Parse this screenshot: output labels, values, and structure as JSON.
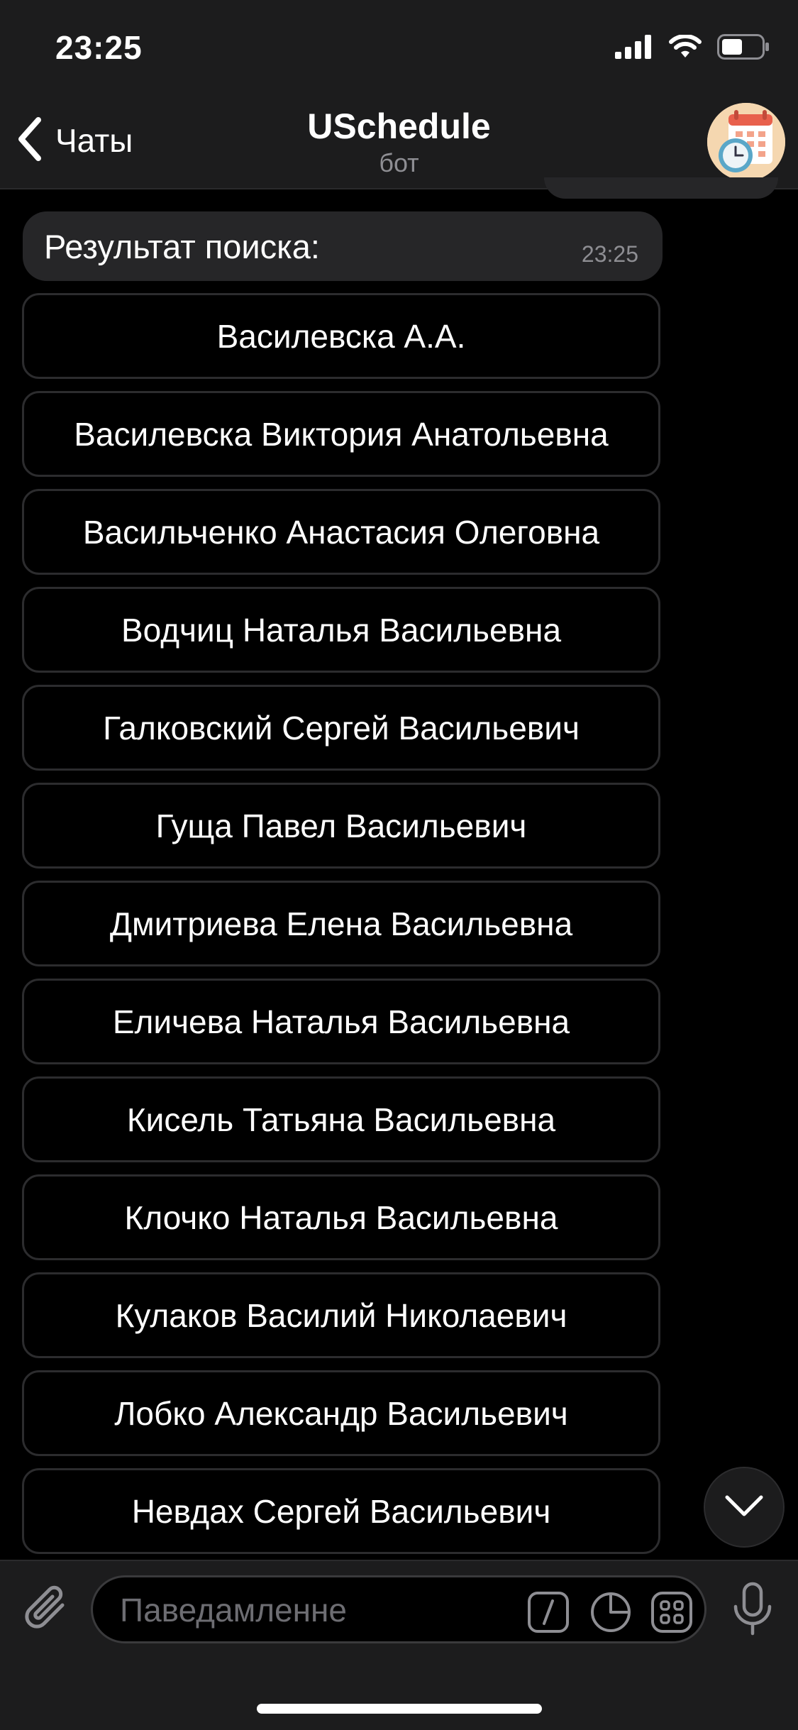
{
  "status": {
    "time": "23:25"
  },
  "nav": {
    "back_label": "Чаты",
    "title": "USchedule",
    "subtitle": "бот"
  },
  "message": {
    "text": "Результат поиска:",
    "time": "23:25"
  },
  "buttons": [
    "Василевска А.А.",
    "Василевска Виктория Анатольевна",
    "Васильченко Анастасия Олеговна",
    "Водчиц Наталья Васильевна",
    "Галковский Сергей Васильевич",
    "Гуща Павел Васильевич",
    "Дмитриева Елена Васильевна",
    "Еличева Наталья Васильевна",
    "Кисель Татьяна Васильевна",
    "Клочко Наталья Васильевна",
    "Кулаков Василий Николаевич",
    "Лобко Александр Васильевич",
    "Невдах Сергей Васильевич"
  ],
  "input": {
    "placeholder": "Паведамленне"
  },
  "icons": {
    "back": "chevron-left-icon",
    "signal": "signal-icon",
    "wifi": "wifi-icon",
    "battery": "battery-icon",
    "attach": "paperclip-icon",
    "commands": "slash-command-icon",
    "sticker": "sticker-icon",
    "bot_keyboard": "keyboard-grid-icon",
    "mic": "microphone-icon",
    "scroll_down": "chevron-down-icon"
  },
  "colors": {
    "background": "#000000",
    "bar": "#1c1c1d",
    "bubble": "#262628",
    "button_border": "#2c2c2e",
    "muted": "#8e8e93"
  }
}
